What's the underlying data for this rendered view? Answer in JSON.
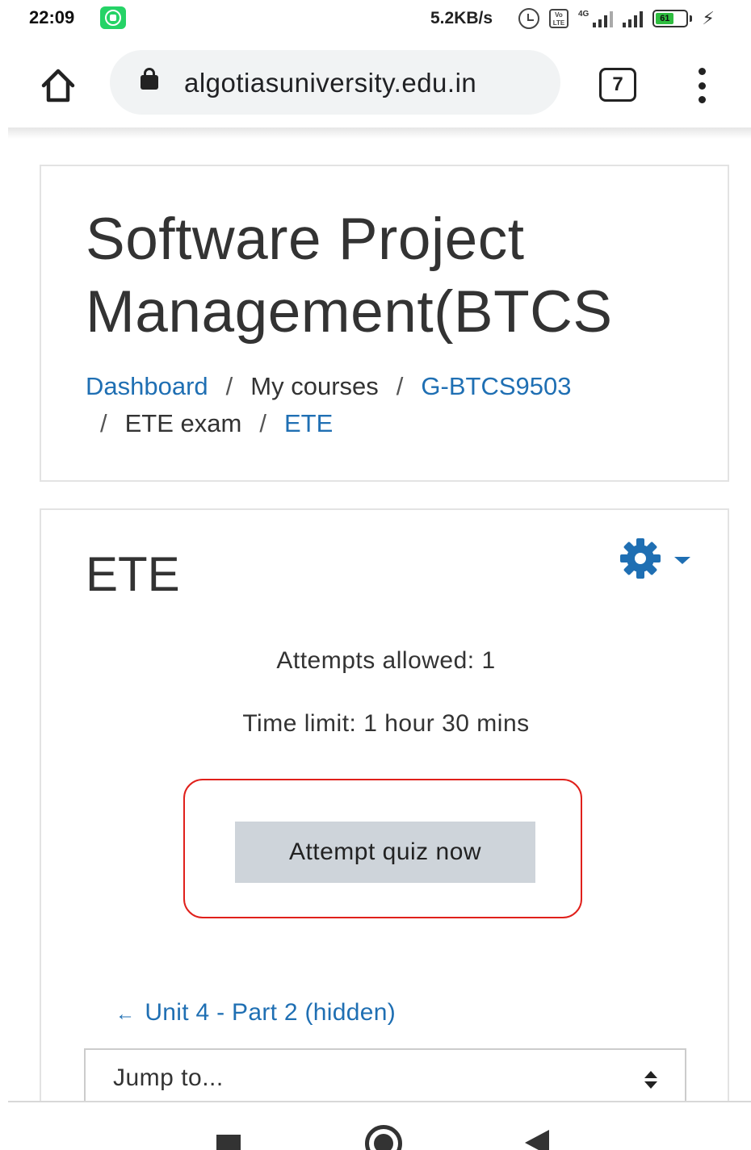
{
  "status_bar": {
    "time": "22:09",
    "net_speed": "5.2KB/s",
    "volte_label": "Vo LTE",
    "network_type": "4G",
    "battery_level": "61",
    "icons": [
      "whatsapp-icon",
      "alarm-icon",
      "volte-icon",
      "signal-icon",
      "battery-icon",
      "charging-icon"
    ]
  },
  "browser": {
    "url": "algotiasuniversity.edu.in",
    "tab_count": "7",
    "icons": [
      "home-icon",
      "lock-icon",
      "tabs-icon",
      "menu-icon"
    ]
  },
  "page_header": {
    "course_title": "Software Project\nManagement(BTCS",
    "breadcrumb": {
      "dashboard": "Dashboard",
      "my_courses": "My courses",
      "course_code": "G-BTCS9503",
      "section": "ETE exam",
      "current": "ETE",
      "separator": "/"
    }
  },
  "quiz": {
    "title": "ETE",
    "attempts_allowed": "Attempts allowed: 1",
    "time_limit": "Time limit: 1 hour 30 mins",
    "attempt_button": "Attempt quiz now",
    "prev_arrow": "←",
    "prev_link": "Unit 4 - Part 2 (hidden)",
    "jump_placeholder": "Jump to...",
    "icons": [
      "gear-icon",
      "caret-down-icon",
      "sort-icon"
    ]
  },
  "colors": {
    "link": "#1f6fb3",
    "highlight_border": "#e0201b",
    "button_bg": "#ced4da",
    "whatsapp": "#25d366",
    "battery_fill": "#2ebd3f"
  },
  "android_nav": {
    "icons": [
      "recents-icon",
      "home-circle-icon",
      "back-icon"
    ]
  }
}
